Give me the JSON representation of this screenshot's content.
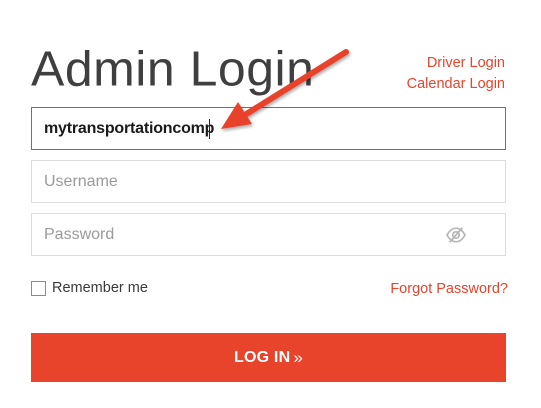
{
  "title": "Admin Login",
  "links": {
    "driver_login": "Driver Login",
    "calendar_login": "Calendar Login"
  },
  "company_field": {
    "value": "mytransportationcomp"
  },
  "username_field": {
    "placeholder": "Username"
  },
  "password_field": {
    "placeholder": "Password",
    "toggle_icon": "eye-slash-icon"
  },
  "remember": {
    "label": "Remember me",
    "checked": false
  },
  "forgot_password": "Forgot Password?",
  "login_button": {
    "label": "LOG IN",
    "icon_glyph": "»",
    "icon": "double-chevron-right-icon"
  },
  "annotation": {
    "icon": "red-arrow-annotation",
    "color": "#e8432b"
  },
  "colors": {
    "accent": "#e8432b",
    "border": "#dcdcdc",
    "placeholder": "#9a9a9a"
  }
}
